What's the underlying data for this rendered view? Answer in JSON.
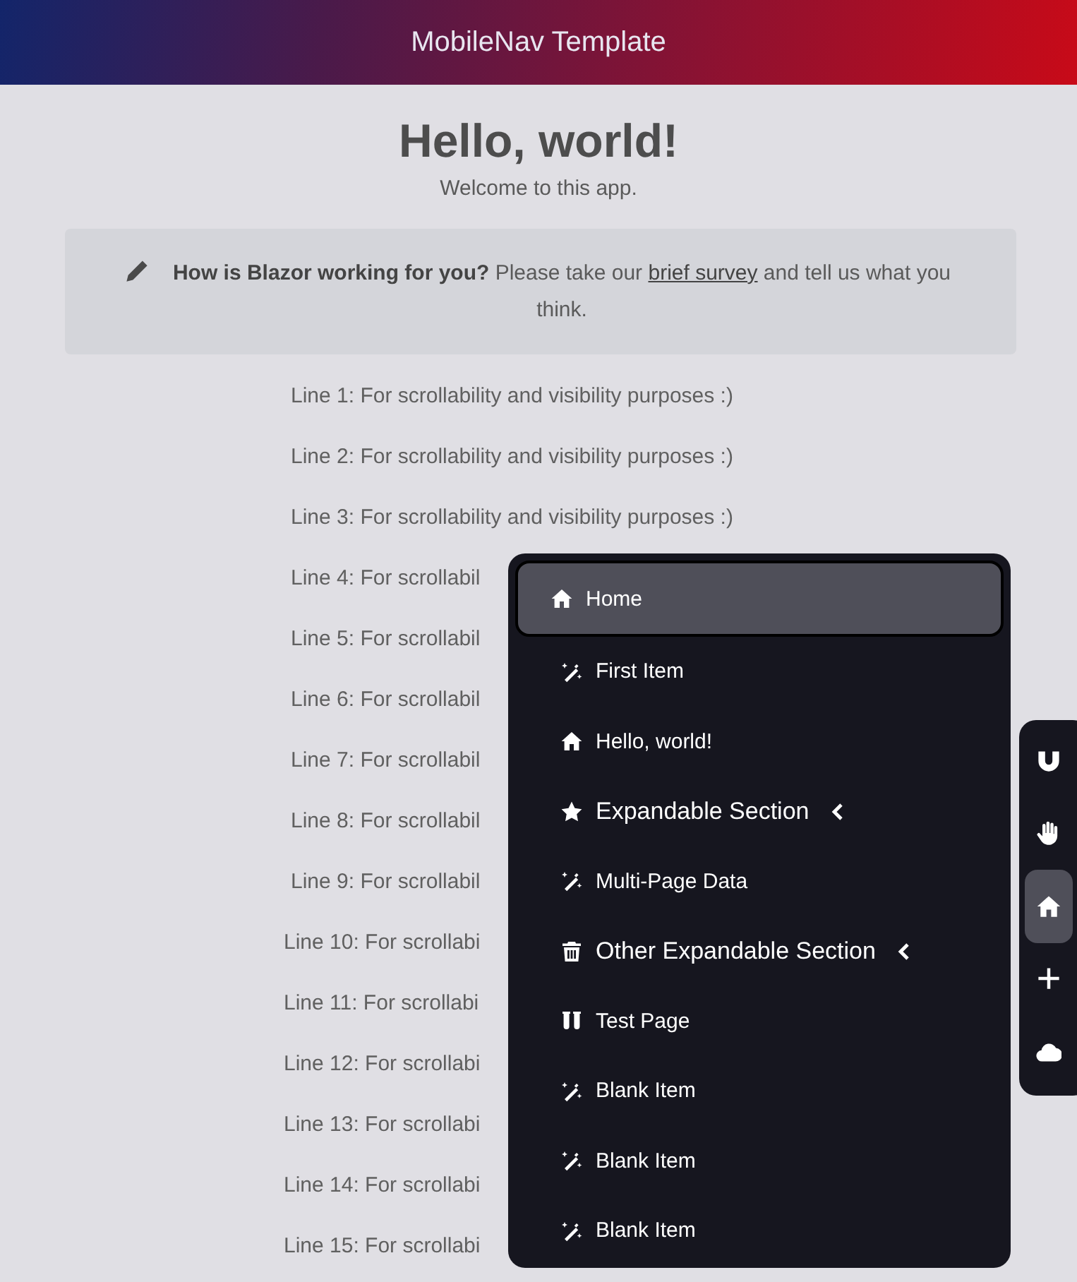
{
  "header": {
    "title": "MobileNav Template"
  },
  "page": {
    "heading": "Hello, world!",
    "subtitle": "Welcome to this app.",
    "survey": {
      "text": "**How is Blazor working for you?** Please take our",
      "link": "brief survey",
      "after": "and tell us what you think."
    },
    "lines": [
      "Line 1: For scrollability and visibility purposes :)",
      "Line 2: For scrollability and visibility purposes :)",
      "Line 3: For scrollability and visibility purposes :)",
      "Line 4: For scrollabil",
      "Line 5: For scrollabil",
      "Line 6: For scrollabil",
      "Line 7: For scrollabil",
      "Line 8: For scrollabil",
      "Line 9: For scrollabil",
      "Line 10: For scrollabi",
      "Line 11: For scrollabi",
      "Line 12: For scrollabi",
      "Line 13: For scrollabi",
      "Line 14: For scrollabi",
      "Line 15: For scrollabi"
    ]
  },
  "menu": {
    "items": [
      {
        "label": "Home",
        "kind": "link",
        "selected": true
      },
      {
        "label": "First Item",
        "kind": "link",
        "selected": false
      },
      {
        "label": "Hello, world!",
        "kind": "link",
        "selected": false
      },
      {
        "label": "Expandable Section",
        "kind": "section",
        "expanded": false
      },
      {
        "label": "Multi-Page Data",
        "kind": "link",
        "selected": false
      },
      {
        "label": "Other Expandable Section",
        "kind": "section",
        "expanded": false
      },
      {
        "label": "Test Page",
        "kind": "link",
        "selected": false
      },
      {
        "label": "Blank Item",
        "kind": "link",
        "selected": false
      },
      {
        "label": "Blank Item",
        "kind": "link",
        "selected": false
      },
      {
        "label": "Blank Item",
        "kind": "link",
        "selected": false
      }
    ]
  },
  "dock": {
    "items": [
      {
        "selected": false
      },
      {
        "selected": false
      },
      {
        "selected": true
      },
      {
        "selected": false
      },
      {
        "selected": false
      }
    ]
  }
}
